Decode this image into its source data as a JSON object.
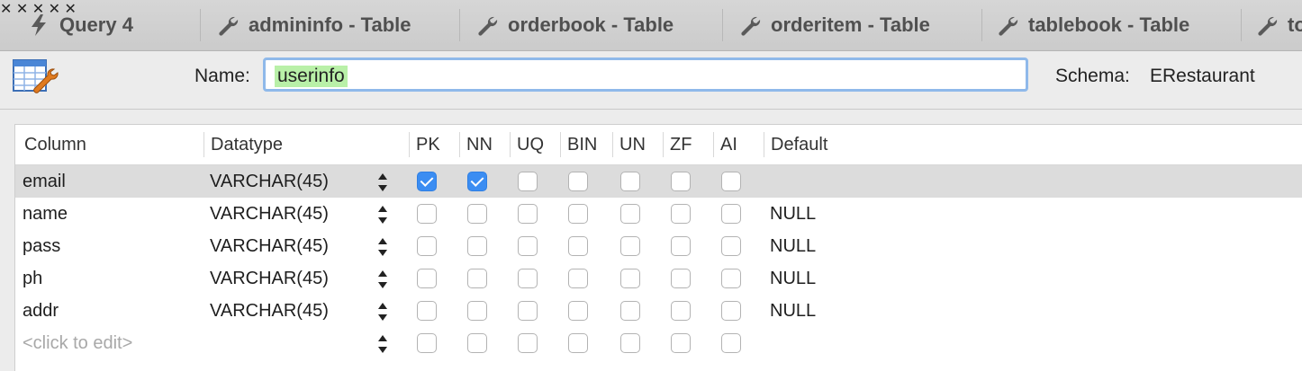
{
  "tabs": [
    {
      "label": "Query 4",
      "icon": "lightning-icon"
    },
    {
      "label": "admininfo - Table",
      "icon": "wrench-icon"
    },
    {
      "label": "orderbook - Table",
      "icon": "wrench-icon"
    },
    {
      "label": "orderitem - Table",
      "icon": "wrench-icon"
    },
    {
      "label": "tablebook - Table",
      "icon": "wrench-icon"
    },
    {
      "label": "to",
      "icon": "wrench-icon"
    }
  ],
  "close_glyph": "✕",
  "header": {
    "name_label": "Name:",
    "name_value": "userinfo",
    "schema_label": "Schema:",
    "schema_value": "ERestaurant"
  },
  "grid": {
    "columns": [
      "Column",
      "Datatype",
      "PK",
      "NN",
      "UQ",
      "BIN",
      "UN",
      "ZF",
      "AI",
      "Default"
    ],
    "rows": [
      {
        "column": "email",
        "datatype": "VARCHAR(45)",
        "pk": true,
        "nn": true,
        "uq": false,
        "bin": false,
        "un": false,
        "zf": false,
        "ai": false,
        "default": "",
        "selected": true
      },
      {
        "column": "name",
        "datatype": "VARCHAR(45)",
        "pk": false,
        "nn": false,
        "uq": false,
        "bin": false,
        "un": false,
        "zf": false,
        "ai": false,
        "default": "NULL",
        "selected": false
      },
      {
        "column": "pass",
        "datatype": "VARCHAR(45)",
        "pk": false,
        "nn": false,
        "uq": false,
        "bin": false,
        "un": false,
        "zf": false,
        "ai": false,
        "default": "NULL",
        "selected": false
      },
      {
        "column": "ph",
        "datatype": "VARCHAR(45)",
        "pk": false,
        "nn": false,
        "uq": false,
        "bin": false,
        "un": false,
        "zf": false,
        "ai": false,
        "default": "NULL",
        "selected": false
      },
      {
        "column": "addr",
        "datatype": "VARCHAR(45)",
        "pk": false,
        "nn": false,
        "uq": false,
        "bin": false,
        "un": false,
        "zf": false,
        "ai": false,
        "default": "NULL",
        "selected": false
      }
    ],
    "new_row_placeholder": "<click to edit>"
  },
  "colors": {
    "selection_row": "#dcdcdc",
    "checkbox_checked": "#3b8df2",
    "input_focus_ring": "#8fb9ea",
    "name_highlight": "#b9f0a8"
  }
}
